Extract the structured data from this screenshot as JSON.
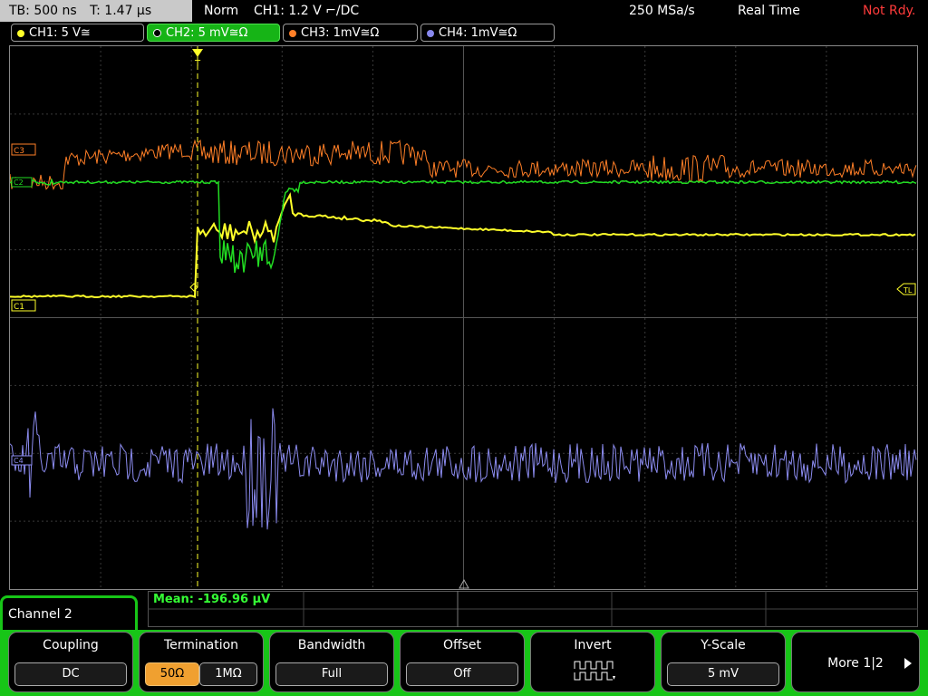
{
  "topbar": {
    "timebase": "TB: 500 ns",
    "trigger_time": "T: 1.47 µs",
    "mode": "Norm",
    "trigger": "CH1: 1.2 V ⌐/DC",
    "sample_rate": "250 MSa/s",
    "acq_mode": "Real Time",
    "state": "Not Rdy."
  },
  "channels": [
    {
      "label": "CH1: 5 V≅",
      "color": "#ffff2a"
    },
    {
      "label": "CH2: 5 mV≅Ω",
      "color": "#16b416"
    },
    {
      "label": "CH3: 1mV≅Ω",
      "color": "#ff7f27"
    },
    {
      "label": "CH4: 1mV≅Ω",
      "color": "#8888ee"
    }
  ],
  "markers": {
    "c3": "C3",
    "c2": "C2",
    "c1": "C1",
    "c4": "C4",
    "tl": "TL",
    "trig": "T"
  },
  "measurement": {
    "mean": "Mean: -196.96 µV"
  },
  "menu": {
    "title": "Channel 2",
    "coupling": {
      "label": "Coupling",
      "value": "DC"
    },
    "termination": {
      "label": "Termination",
      "opt1": "50Ω",
      "opt2": "1MΩ",
      "selected": "50Ω"
    },
    "bandwidth": {
      "label": "Bandwidth",
      "value": "Full"
    },
    "offset": {
      "label": "Offset",
      "value": "Off"
    },
    "invert": {
      "label": "Invert"
    },
    "yscale": {
      "label": "Y-Scale",
      "value": "5 mV"
    },
    "more": {
      "label": "More 1|2"
    }
  }
}
